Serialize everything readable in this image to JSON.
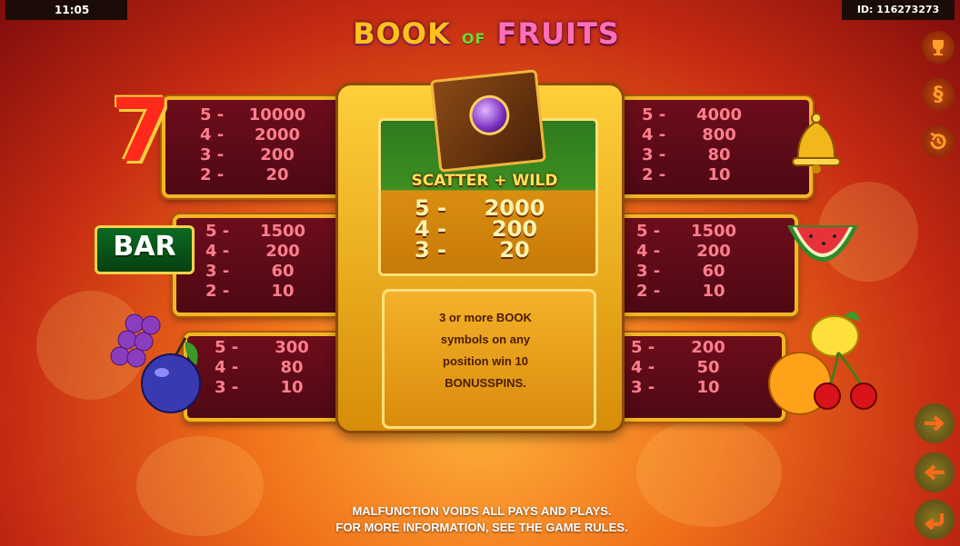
{
  "status_bar": {
    "time": "11:05",
    "id": "ID: 116273273"
  },
  "logo": {
    "part1": "BOOK",
    "part2": "OF",
    "part3": "FRUITS"
  },
  "paytable": {
    "seven": [
      {
        "count": "5 -",
        "value": "10000"
      },
      {
        "count": "4 -",
        "value": "2000"
      },
      {
        "count": "3 -",
        "value": "200"
      },
      {
        "count": "2 -",
        "value": "20"
      }
    ],
    "bar": [
      {
        "count": "5 -",
        "value": "1500"
      },
      {
        "count": "4 -",
        "value": "200"
      },
      {
        "count": "3 -",
        "value": "60"
      },
      {
        "count": "2 -",
        "value": "10"
      }
    ],
    "plum_grapes": [
      {
        "count": "5 -",
        "value": "300"
      },
      {
        "count": "4 -",
        "value": "80"
      },
      {
        "count": "3 -",
        "value": "10"
      }
    ],
    "bell": [
      {
        "count": "5 -",
        "value": "4000"
      },
      {
        "count": "4 -",
        "value": "800"
      },
      {
        "count": "3 -",
        "value": "80"
      },
      {
        "count": "2 -",
        "value": "10"
      }
    ],
    "melon": [
      {
        "count": "5 -",
        "value": "1500"
      },
      {
        "count": "4 -",
        "value": "200"
      },
      {
        "count": "3 -",
        "value": "60"
      },
      {
        "count": "2 -",
        "value": "10"
      }
    ],
    "citrus_cherry": [
      {
        "count": "5 -",
        "value": "200"
      },
      {
        "count": "4 -",
        "value": "50"
      },
      {
        "count": "3 -",
        "value": "10"
      }
    ]
  },
  "scatter": {
    "label": "SCATTER + WILD",
    "pays": [
      {
        "count": "5 -",
        "value": "2000"
      },
      {
        "count": "4 -",
        "value": "200"
      },
      {
        "count": "3 -",
        "value": "20"
      }
    ]
  },
  "bonus_info": {
    "line1": "3 or more BOOK",
    "line2": "symbols on any",
    "line3": "position win 10",
    "line4": "BONUSSPINS."
  },
  "symbols": {
    "bar_label": "BAR",
    "seven_label": "7"
  },
  "side_buttons": [
    {
      "icon": "trophy-icon"
    },
    {
      "icon": "paragraph-icon",
      "glyph": "§"
    },
    {
      "icon": "history-icon"
    }
  ],
  "nav_buttons": [
    {
      "icon": "arrow-right-icon"
    },
    {
      "icon": "arrow-left-icon"
    },
    {
      "icon": "return-icon"
    }
  ],
  "footer": {
    "line1": "MALFUNCTION VOIDS ALL PAYS AND PLAYS.",
    "line2": "FOR MORE INFORMATION, SEE THE GAME RULES."
  },
  "colors": {
    "panel_border": "#f3b526",
    "pay_text": "#ff7e8d",
    "accent_orange": "#ff6a1a"
  }
}
